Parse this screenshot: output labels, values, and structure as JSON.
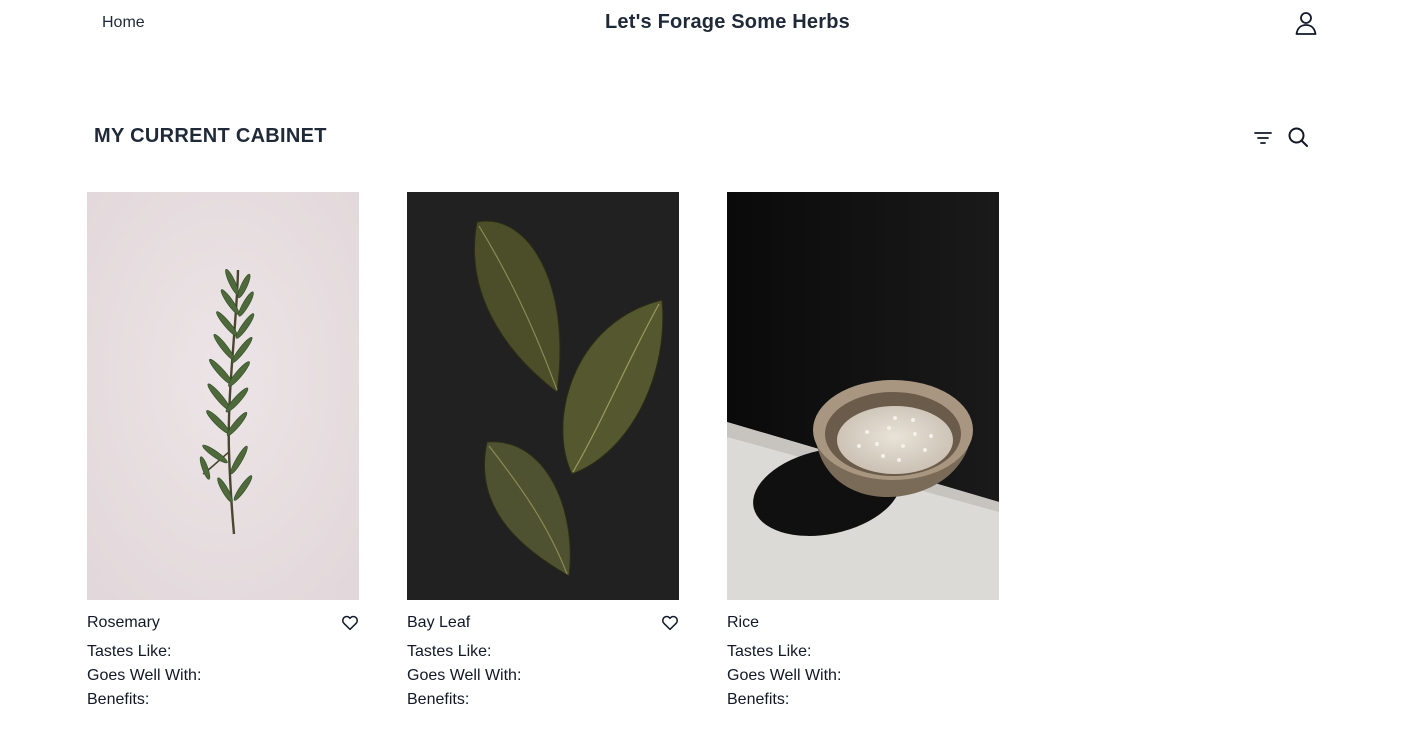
{
  "nav": {
    "home_label": "Home",
    "site_title": "Let's Forage Some Herbs",
    "user_icon": "user-icon"
  },
  "cabinet": {
    "title": "MY CURRENT CABINET",
    "filter_icon": "filter-icon",
    "search_icon": "search-icon"
  },
  "labels": {
    "tastes_like": "Tastes Like:",
    "goes_well_with": "Goes Well With:",
    "benefits": "Benefits:"
  },
  "items": [
    {
      "name": "Rosemary",
      "image": "rosemary-sprig",
      "favorite_icon": "heart-icon"
    },
    {
      "name": "Bay Leaf",
      "image": "bay-leaves",
      "favorite_icon": "heart-icon"
    },
    {
      "name": "Rice",
      "image": "rice-bowl"
    }
  ],
  "colors": {
    "rosemary_bg": "#e8dfe0",
    "bay_bg": "#212121",
    "rice_bg": "#0f0f0f"
  }
}
